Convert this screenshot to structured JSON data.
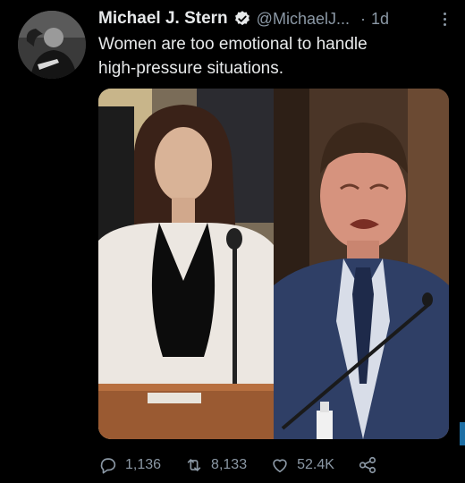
{
  "tweet": {
    "display_name": "Michael J. Stern",
    "handle": "@MichaelJ...",
    "separator": "·",
    "time": "1d",
    "text_line1": "Women are too emotional to handle",
    "text_line2": "high-pressure situations."
  },
  "icons": {
    "avatar": "avatar-photo",
    "verified": "verified-badge-icon",
    "more": "more-options-icon",
    "reply": "reply-icon",
    "retweet": "retweet-icon",
    "like": "heart-icon",
    "share": "share-icon"
  },
  "stats": {
    "replies": "1,136",
    "retweets": "8,133",
    "likes": "52.4K"
  },
  "colors": {
    "background": "#000000",
    "text": "#e7e9ea",
    "muted": "#8b98a5"
  }
}
